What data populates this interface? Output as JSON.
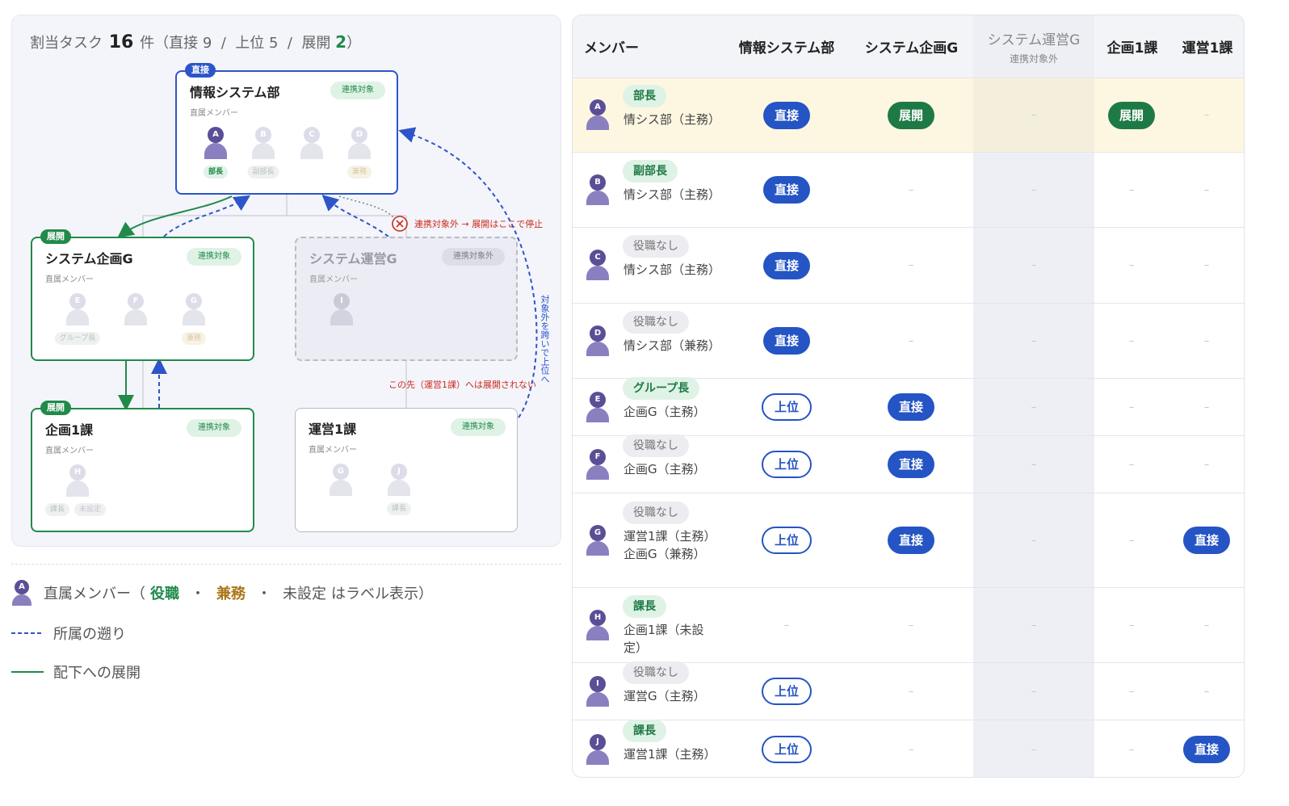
{
  "summary": {
    "prefix": "割当タスク",
    "total": "16",
    "suffix": "件（直接",
    "direct": "9",
    "sep1": "/",
    "upper_label": "上位",
    "upper": "5",
    "sep2": "/",
    "expand_label": "展開",
    "expand": "2",
    "close": "）"
  },
  "diagram": {
    "nodes": {
      "info_sys": {
        "badge": "直接",
        "title": "情報システム部",
        "status": "連携対象",
        "sub": "直属メンバー",
        "members": [
          {
            "letter": "A",
            "tag": "部長"
          },
          {
            "letter": "B",
            "tag": "副部長"
          },
          {
            "letter": "C",
            "tag": ""
          },
          {
            "letter": "D",
            "tag": "兼務"
          }
        ]
      },
      "sys_plan": {
        "badge": "展開",
        "title": "システム企画G",
        "status": "連携対象",
        "sub": "直属メンバー",
        "members": [
          {
            "letter": "E",
            "tag": "グループ長"
          },
          {
            "letter": "F",
            "tag": ""
          },
          {
            "letter": "G",
            "tag": "兼務"
          }
        ]
      },
      "sys_ops": {
        "title": "システム運営G",
        "status": "連携対象外",
        "sub": "直属メンバー",
        "members": [
          {
            "letter": "I",
            "tag": ""
          }
        ]
      },
      "plan1": {
        "badge": "展開",
        "title": "企画1課",
        "status": "連携対象",
        "sub": "直属メンバー",
        "members": [
          {
            "letter": "H",
            "tag": "課長"
          },
          {
            "letter": "",
            "tag": "未設定"
          }
        ]
      },
      "ops1": {
        "title": "運営1課",
        "status": "連携対象",
        "sub": "直属メンバー",
        "members": [
          {
            "letter": "G",
            "tag": ""
          },
          {
            "letter": "J",
            "tag": "課長"
          }
        ]
      }
    },
    "annotations": {
      "stop": "連携対象外 → 展開はここで停止",
      "no_expand": "この先（運営1課）へは展開されない",
      "skip_up": "対象外を跨いで上位へ"
    }
  },
  "legend": {
    "avatar_letter": "A",
    "members_prefix": "直属メンバー（",
    "role": "役職",
    "dot1": "・",
    "concurrent": "兼務",
    "dot2": "・",
    "unset": "未設定",
    "members_suffix": "はラベル表示）",
    "trace_up": "所属の遡り",
    "expand_down": "配下への展開"
  },
  "table": {
    "headers": {
      "member": "メンバー",
      "info_sys": "情報システム部",
      "sys_plan": "システム企画G",
      "sys_ops": "システム運営G",
      "sys_ops_sub": "連携対象外",
      "plan1": "企画1課",
      "ops1": "運営1課"
    },
    "dash": "–",
    "rows": [
      {
        "letter": "A",
        "role": "部長",
        "dept": "情シス部（主務）",
        "cells": [
          "直接",
          "展開",
          "",
          "展開",
          ""
        ]
      },
      {
        "letter": "B",
        "role": "副部長",
        "dept": "情シス部（主務）",
        "cells": [
          "直接",
          "",
          "",
          "",
          ""
        ]
      },
      {
        "letter": "C",
        "role": "役職なし",
        "dept": "情シス部（主務）",
        "cells": [
          "直接",
          "",
          "",
          "",
          ""
        ]
      },
      {
        "letter": "D",
        "role": "役職なし",
        "dept": "情シス部（兼務）",
        "cells": [
          "直接",
          "",
          "",
          "",
          ""
        ]
      },
      {
        "letter": "E",
        "role": "グループ長",
        "dept": "企画G（主務）",
        "cells": [
          "上位",
          "直接",
          "",
          "",
          ""
        ]
      },
      {
        "letter": "F",
        "role": "役職なし",
        "dept": "企画G（主務）",
        "cells": [
          "上位",
          "直接",
          "",
          "",
          ""
        ]
      },
      {
        "letter": "G",
        "role": "役職なし",
        "dept": "運営1課（主務）",
        "dept2": "企画G（兼務）",
        "cells": [
          "上位",
          "直接",
          "",
          "",
          "直接"
        ]
      },
      {
        "letter": "H",
        "role": "課長",
        "dept": "企画1課（未設定）",
        "cells": [
          "",
          "",
          "",
          "",
          ""
        ]
      },
      {
        "letter": "I",
        "role": "役職なし",
        "dept": "運営G（主務）",
        "cells": [
          "上位",
          "",
          "",
          "",
          ""
        ]
      },
      {
        "letter": "J",
        "role": "課長",
        "dept": "運営1課（主務）",
        "cells": [
          "上位",
          "",
          "",
          "",
          "直接"
        ]
      }
    ]
  },
  "colors": {
    "direct_blue": "#2554c4",
    "expand_green": "#1e7a44",
    "highlight_row": "#fdf7e1",
    "stop_red": "#cc2a1f"
  }
}
